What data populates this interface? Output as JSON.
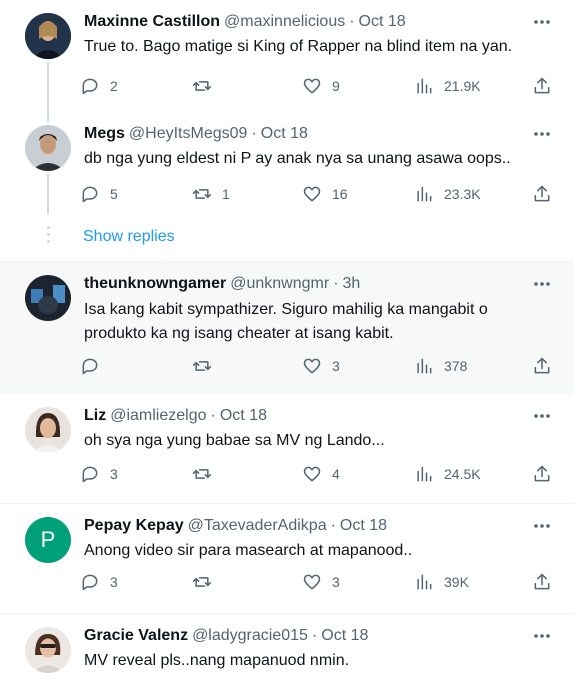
{
  "tweets": [
    {
      "name": "Maxinne Castillon",
      "handle": "@maxinnelicious",
      "time": "Oct 18",
      "text": "True to. Bago matige si King of Rapper na blind item na yan.",
      "replies": "2",
      "retweets": "",
      "likes": "9",
      "views": "21.9K"
    },
    {
      "name": "Megs",
      "handle": "@HeyItsMegs09",
      "time": "Oct 18",
      "text": "db nga yung eldest ni P  ay anak nya sa unang asawa oops..",
      "replies": "5",
      "retweets": "1",
      "likes": "16",
      "views": "23.3K"
    },
    {
      "name": "theunknowngamer",
      "handle": "@unknwngmr",
      "time": "3h",
      "text": "Isa kang kabit sympathizer. Siguro mahilig ka mangabit o produkto ka ng isang cheater at isang kabit.",
      "replies": "",
      "retweets": "",
      "likes": "3",
      "views": "378"
    },
    {
      "name": "Liz",
      "handle": "@iamliezelgo",
      "time": "Oct 18",
      "text": "oh sya nga yung babae sa MV ng Lando...",
      "replies": "3",
      "retweets": "",
      "likes": "4",
      "views": "24.5K"
    },
    {
      "name": "Pepay Kepay",
      "handle": "@TaxevaderAdikpa",
      "time": "Oct 18",
      "text": "Anong video sir para masearch at mapanood..",
      "avatar_letter": "P",
      "replies": "3",
      "retweets": "",
      "likes": "3",
      "views": "39K"
    },
    {
      "name": "Gracie Valenz",
      "handle": "@ladygracie015",
      "time": "Oct 18",
      "text": "MV reveal pls..nang mapanuod nmin."
    }
  ],
  "show_replies_label": "Show replies",
  "separator": "·",
  "colors": {
    "accent": "#1d9bf0",
    "muted": "#536471",
    "avatar_p": "#00a07a"
  },
  "icons": [
    "reply-icon",
    "retweet-icon",
    "like-icon",
    "views-icon",
    "share-icon",
    "more-icon"
  ]
}
